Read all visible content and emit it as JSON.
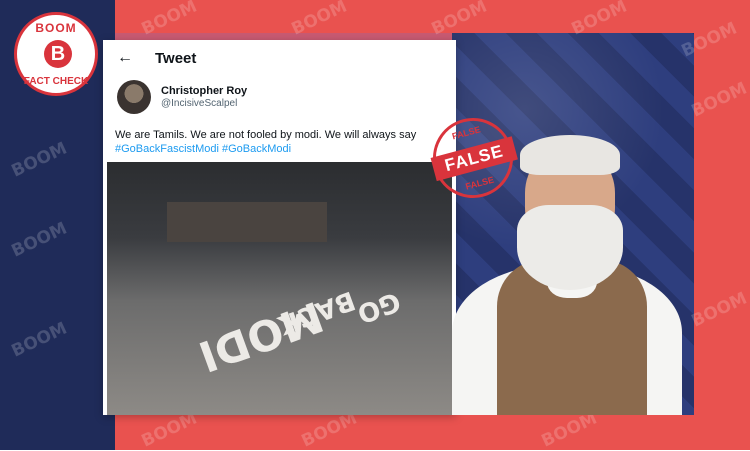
{
  "brand": {
    "logo_top": "BOOM",
    "logo_letter": "B",
    "logo_bottom": "FACT CHECK",
    "watermark": "BOOM"
  },
  "tweet": {
    "header_title": "Tweet",
    "author_name": "Christopher Roy",
    "author_handle": "@IncisiveScalpel",
    "text": "We are Tamils. We are not fooled by modi. We will always say",
    "hashtags": "#GoBackFascistModi #GoBackModi"
  },
  "photo": {
    "street_words": [
      "GO",
      "BACK",
      "MODI"
    ]
  },
  "stamp": {
    "top": "FALSE",
    "label": "FALSE",
    "bottom": "FALSE"
  },
  "colors": {
    "brand_red": "#e9524f",
    "navy": "#1f2b59",
    "link_blue": "#1d9bf0"
  }
}
